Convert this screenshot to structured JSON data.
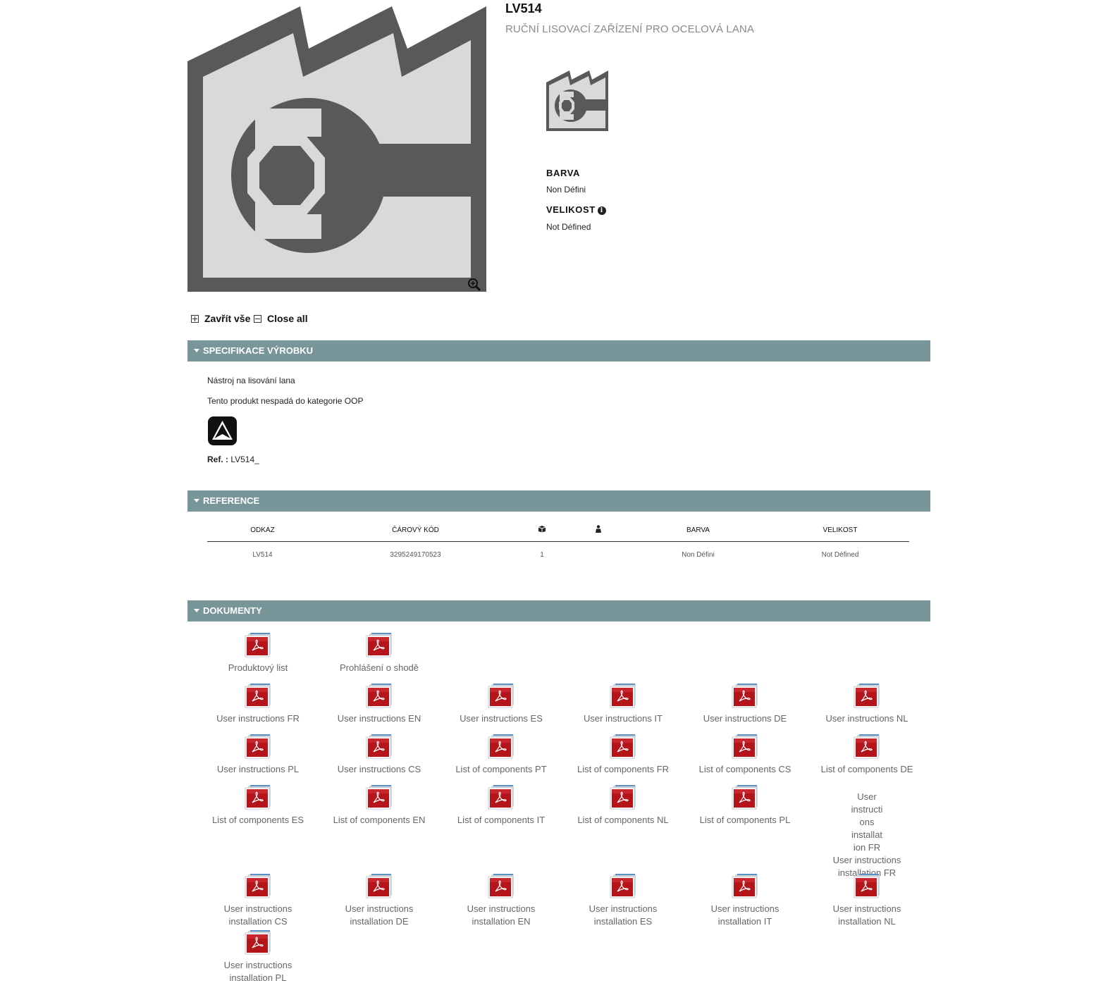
{
  "product": {
    "code": "LV514",
    "name": "RUČNÍ LISOVACÍ ZAŘÍZENÍ PRO OCELOVÁ LANA",
    "main_image_icon": "factory-wrench-icon",
    "thumbnail_icon": "factory-wrench-icon"
  },
  "attributes": {
    "color_label": "BARVA",
    "color_value": "Non Défini",
    "size_label": "VELIKOST",
    "size_value": "Not Défined"
  },
  "toggles": {
    "expand_all": "Zavřít vše",
    "close_all": "Close all"
  },
  "sections": {
    "spec": {
      "title": "SPECIFIKACE VÝROBKU",
      "line1": "Nástroj na lisování lana",
      "line2": "Tento produkt nespadá do kategorie OOP",
      "ref_label": "Ref. :",
      "ref_value": "LV514_"
    },
    "reference": {
      "title": "REFERENCE",
      "headers": {
        "odkaz": "ODKAZ",
        "barcode": "ČÁROVÝ KÓD",
        "box_icon": "box-icon",
        "person_icon": "person-icon",
        "barva": "BARVA",
        "velikost": "VELIKOST"
      },
      "row": {
        "odkaz": "LV514",
        "barcode": "3295249170523",
        "qty": "1",
        "person": "",
        "barva": "Non Défini",
        "velikost": "Not Défined"
      }
    },
    "documents": {
      "title": "DOKUMENTY",
      "items": [
        "Produktový list",
        "Prohlášení o shodě",
        "User instructions FR",
        "User instructions EN",
        "User instructions ES",
        "User instructions IT",
        "User instructions DE",
        "User instructions NL",
        "User instructions PL",
        "User instructions CS",
        "List of components PT",
        "List of components FR",
        "List of components CS",
        "List of components DE",
        "List of components ES",
        "List of components EN",
        "List of components IT",
        "List of components NL",
        "List of components PL",
        "User instructions installation FR",
        "User instructions installation CS",
        "User instructions installation DE",
        "User instructions installation EN",
        "User instructions installation ES",
        "User instructions installation IT",
        "User instructions installation NL",
        "User instructions installation PL"
      ],
      "broken_image_alt": "User instructi ons installat ion FR"
    }
  },
  "colors": {
    "section_bar": "#78959a",
    "pdf_red": "#b3151b",
    "icon_dark": "#58595b",
    "icon_light": "#d9d9d9"
  }
}
